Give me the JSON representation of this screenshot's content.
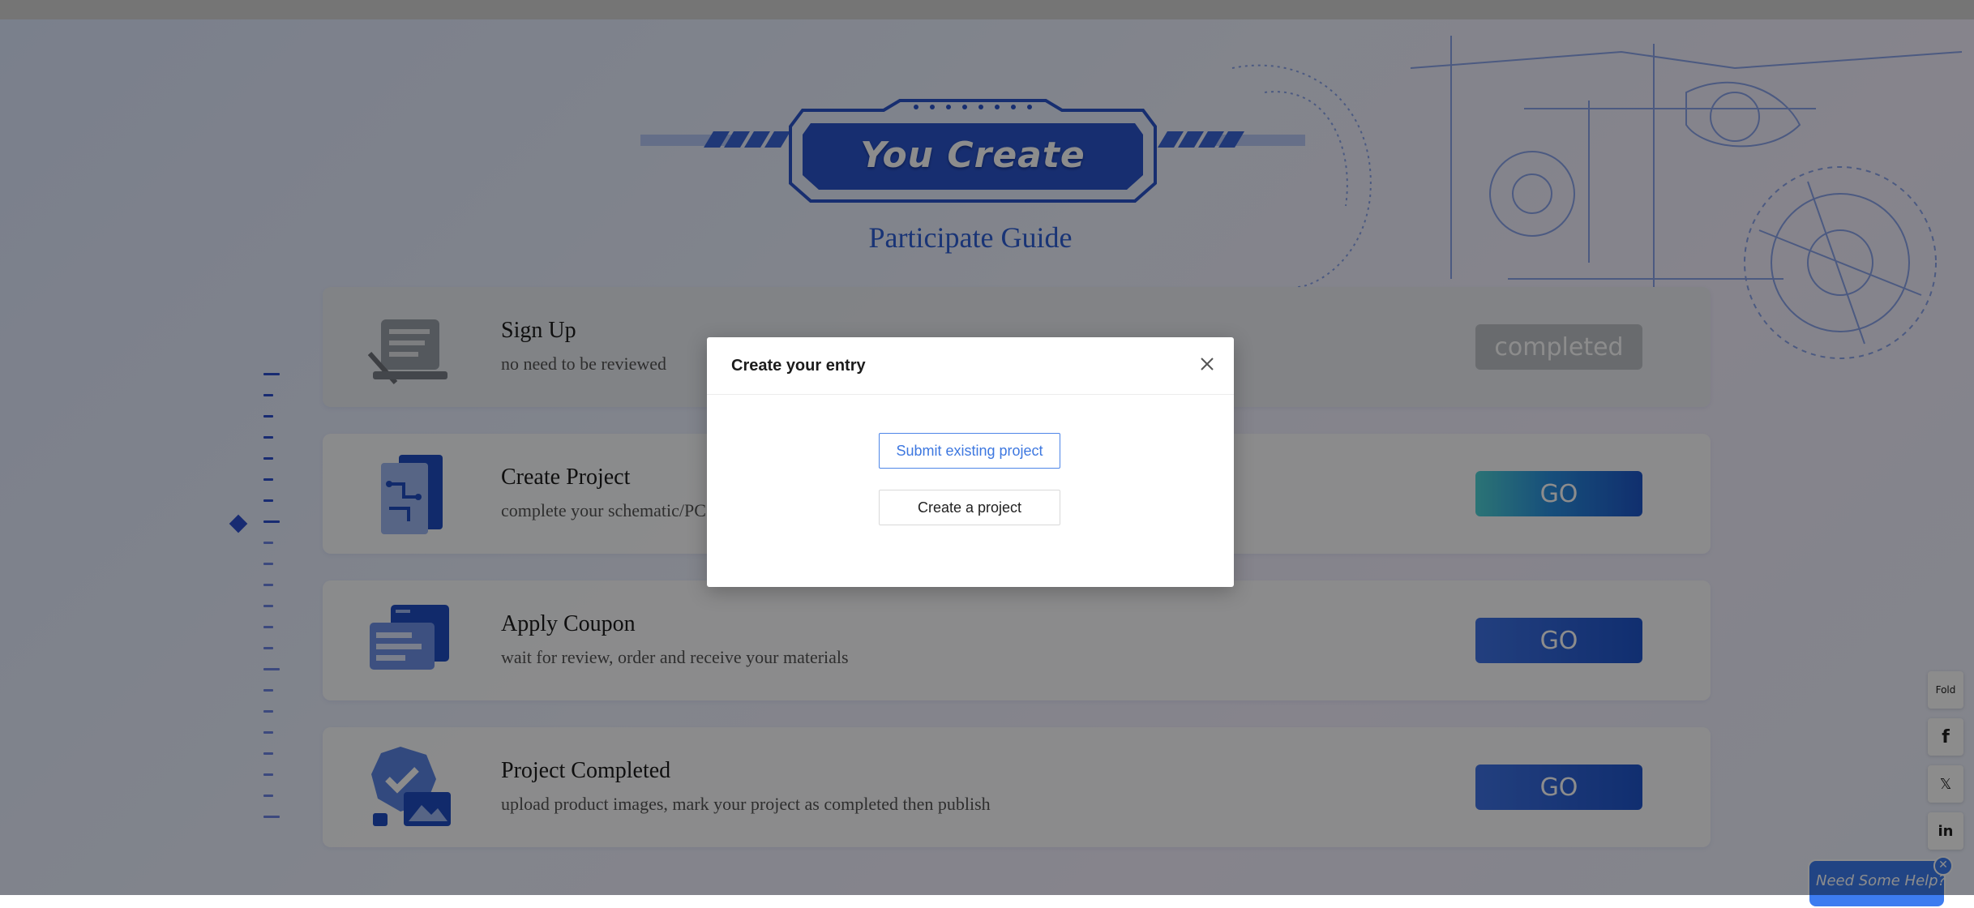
{
  "banner": {
    "title": "You Create",
    "subtitle": "Participate Guide"
  },
  "steps": [
    {
      "title": "Sign Up",
      "desc": "no need to be reviewed",
      "button": "completed",
      "status": "done"
    },
    {
      "title": "Create Project",
      "desc": "complete your schematic/PC",
      "button": "GO",
      "status": "current"
    },
    {
      "title": "Apply Coupon",
      "desc": "wait for review, order and receive your materials",
      "button": "GO",
      "status": "todo"
    },
    {
      "title": "Project Completed",
      "desc": "upload product images, mark your project as completed then publish",
      "button": "GO",
      "status": "todo"
    }
  ],
  "side_tools": {
    "fold": "Fold",
    "facebook": "f",
    "x": "𝕏",
    "linkedin": "in"
  },
  "help": {
    "label": "Need Some Help?",
    "close": "✕"
  },
  "modal": {
    "title": "Create your entry",
    "close": "✕",
    "submit_existing": "Submit existing project",
    "create_project": "Create a project"
  },
  "colors": {
    "accent": "#2d4fd0",
    "button_blue": "#1f55cc",
    "link_blue": "#3e78e0"
  }
}
